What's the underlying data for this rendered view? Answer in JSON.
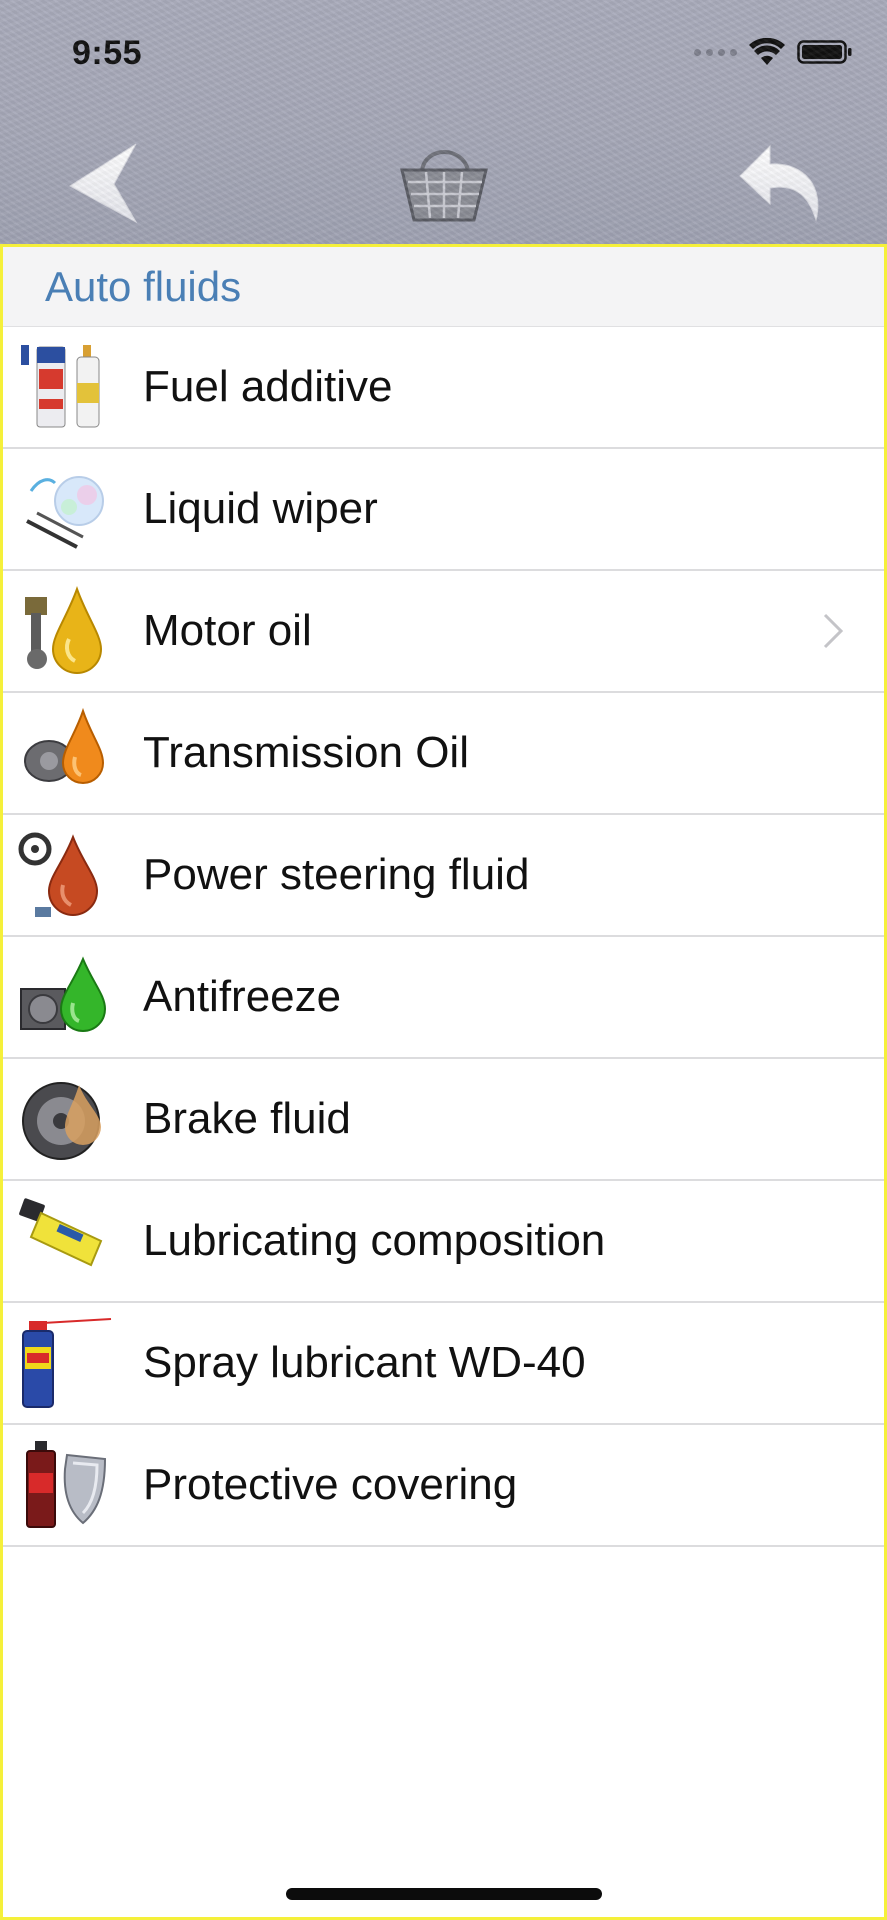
{
  "status_bar": {
    "time": "9:55",
    "icons": [
      "cellular-dots-icon",
      "wifi-icon",
      "battery-icon"
    ]
  },
  "navigation": {
    "back_icon": "back-arrow-icon",
    "center_icon": "shopping-basket-icon",
    "right_icon": "undo-arrow-icon"
  },
  "section": {
    "title": "Auto fluids"
  },
  "items": [
    {
      "label": "Fuel additive",
      "icon": "fuel-additive-icon",
      "has_chevron": false
    },
    {
      "label": "Liquid wiper",
      "icon": "liquid-wiper-icon",
      "has_chevron": false
    },
    {
      "label": "Motor oil",
      "icon": "motor-oil-icon",
      "has_chevron": true
    },
    {
      "label": "Transmission Oil",
      "icon": "transmission-oil-icon",
      "has_chevron": false
    },
    {
      "label": "Power steering fluid",
      "icon": "power-steering-fluid-icon",
      "has_chevron": false
    },
    {
      "label": "Antifreeze",
      "icon": "antifreeze-icon",
      "has_chevron": false
    },
    {
      "label": "Brake fluid",
      "icon": "brake-fluid-icon",
      "has_chevron": false
    },
    {
      "label": "Lubricating composition",
      "icon": "lubricating-composition-icon",
      "has_chevron": false
    },
    {
      "label": "Spray lubricant WD-40",
      "icon": "spray-lubricant-icon",
      "has_chevron": false
    },
    {
      "label": "Protective covering",
      "icon": "protective-covering-icon",
      "has_chevron": false
    }
  ],
  "colors": {
    "accent": "#4a7fb5",
    "frame_border": "#f5f03a",
    "header_bg": "#a6a8b8"
  }
}
